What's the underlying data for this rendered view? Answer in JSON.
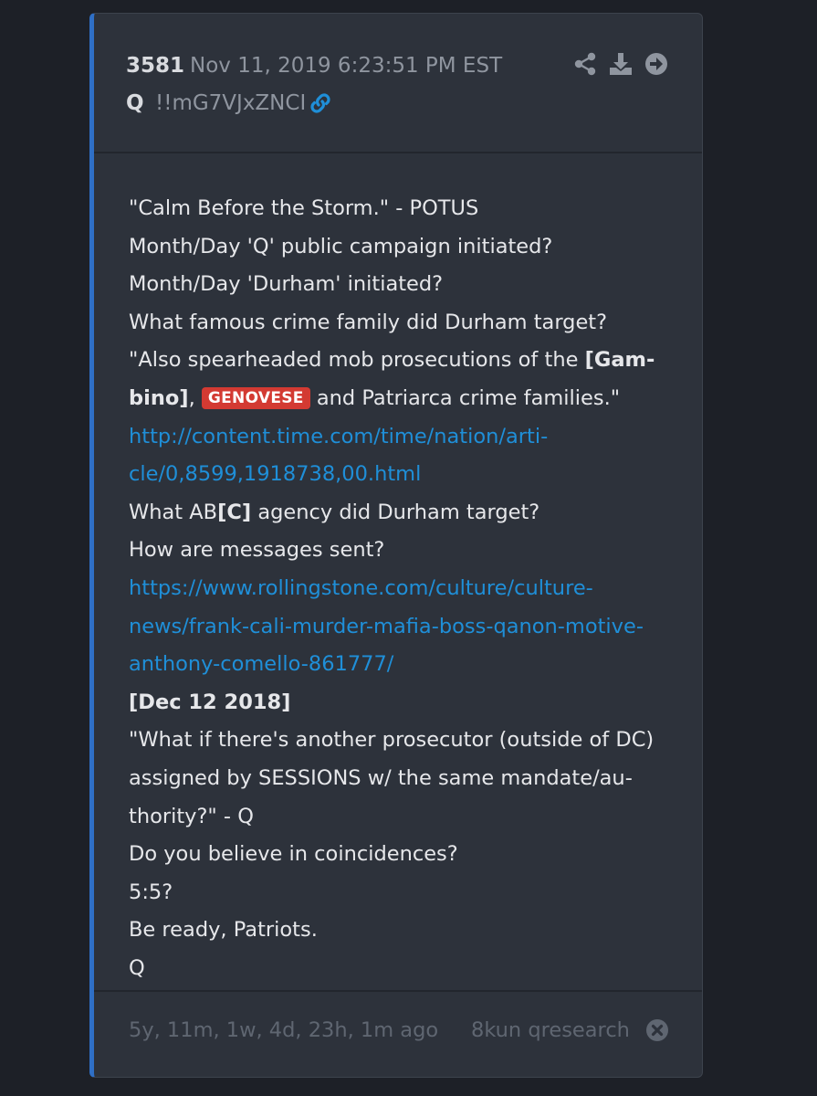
{
  "post": {
    "number": "3581",
    "date": "Nov 11, 2019 6:23:51 PM EST",
    "author": "Q",
    "tripcode": "!!mG7VJxZNCI"
  },
  "header_icons": [
    "link-icon",
    "share-icon",
    "download-icon",
    "arrow-right-circle-icon"
  ],
  "body": {
    "line1": "\"Calm Before the Storm.\" - POTUS",
    "line2": "Month/Day 'Q' public campaign initiated?",
    "line3": "Month/Day 'Durham' initiated?",
    "line4": "What famous crime family did Durham target?",
    "line5_text": "\"Also spearheaded mob prosecutions of the ",
    "line5_bold": "[Gam-",
    "line6_bold": "bino]",
    "line6_comma": ", ",
    "badge": "GENOVESE",
    "line6_rest": " and Patriarca crime families.\"",
    "link1_a": "http://content.time.com/time/nation/arti-",
    "link1_b": "cle/0,8599,1918738,00.html",
    "line9_text": "What AB",
    "line9_bold": "[C]",
    "line9_rest": " agency did Durham target?",
    "line10": "How are messages sent?",
    "link2_a": "https://www.rollingstone.com/culture/culture-",
    "link2_b": "news/frank-cali-murder-mafia-boss-qanon-motive-",
    "link2_c": "anthony-comello-861777/",
    "line14": "[Dec 12 2018]",
    "line15": "\"What if there's another prosecutor (outside of DC)",
    "line16": "assigned by SESSIONS w/ the same mandate/au-",
    "line17": "thority?\" - Q",
    "line18": "Do you believe in coincidences?",
    "line19": "5:5?",
    "line20": "Be ready, Patriots.",
    "line21": "Q"
  },
  "footer": {
    "ago": "5y, 11m, 1w, 4d, 23h, 1m ago",
    "board": "8kun qresearch"
  },
  "colors": {
    "background": "#1d2027",
    "card": "#2d323b",
    "accent": "#2f6fc6",
    "link": "#1f8fd8",
    "badge": "#d33a32"
  }
}
